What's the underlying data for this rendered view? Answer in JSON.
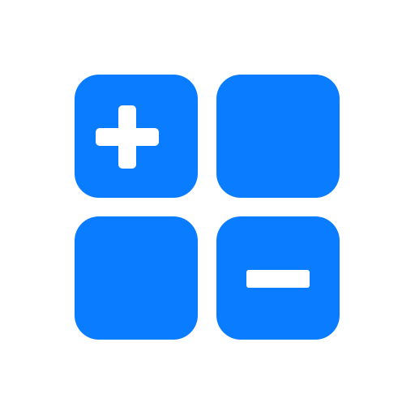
{
  "icon": {
    "name": "calculator-icon",
    "accent_color": "#0A7CFF",
    "symbol_color": "#FFFFFF",
    "background_color": "#FFFFFF",
    "tiles": [
      {
        "position": "top-left",
        "symbol": "plus"
      },
      {
        "position": "top-right",
        "symbol": "none"
      },
      {
        "position": "bottom-left",
        "symbol": "none"
      },
      {
        "position": "bottom-right",
        "symbol": "minus"
      }
    ]
  }
}
